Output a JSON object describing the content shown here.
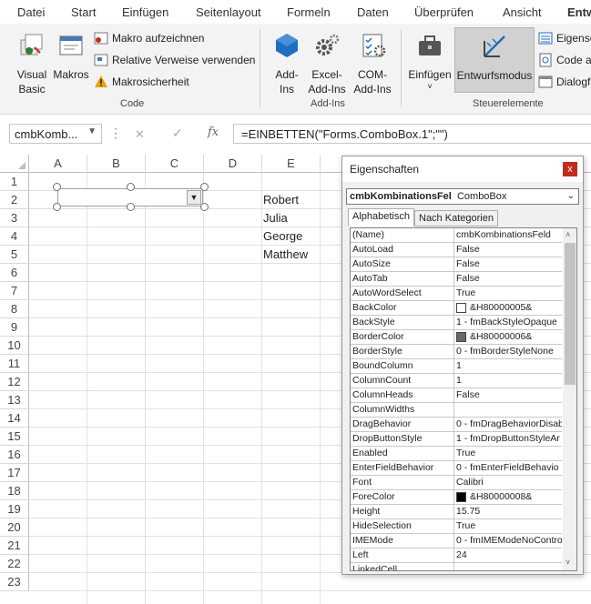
{
  "tabs": [
    "Datei",
    "Start",
    "Einfügen",
    "Seitenlayout",
    "Formeln",
    "Daten",
    "Überprüfen",
    "Ansicht",
    "Entw"
  ],
  "ribbon": {
    "code": {
      "visual_basic": "Visual Basic",
      "makros": "Makros",
      "makro_aufzeichnen": "Makro aufzeichnen",
      "relative_verweise": "Relative Verweise verwenden",
      "makrosicherheit": "Makrosicherheit",
      "group_label": "Code"
    },
    "addins": {
      "addins": "Add-Ins",
      "excel_addins": "Excel-Add-Ins",
      "com_addins": "COM-Add-Ins",
      "group_label": "Add-Ins"
    },
    "controls": {
      "einfuegen": "Einfügen",
      "entwurfsmodus": "Entwurfsmodus",
      "eigenschaften": "Eigensc",
      "code_anzeigen": "Code ar",
      "dialog": "Dialogfe",
      "group_label": "Steuerelemente"
    }
  },
  "formula_bar": {
    "name_box": "cmbKomb...",
    "fx": "fx",
    "formula": "=EINBETTEN(\"Forms.ComboBox.1\";\"\")"
  },
  "sheet": {
    "columns": [
      "A",
      "B",
      "C",
      "D",
      "E"
    ],
    "rows": [
      "1",
      "2",
      "3",
      "4",
      "5",
      "6",
      "7",
      "8",
      "9",
      "10",
      "11",
      "12",
      "13",
      "14",
      "15",
      "16",
      "17",
      "18",
      "19",
      "20",
      "21",
      "22",
      "23"
    ],
    "names": [
      "Robert",
      "Julia",
      "George",
      "Matthew"
    ]
  },
  "properties": {
    "title": "Eigenschaften",
    "close": "x",
    "object_name": "cmbKombinationsFel",
    "object_type": "ComboBox",
    "tab_alpha": "Alphabetisch",
    "tab_cat": "Nach Kategorien",
    "rows": [
      {
        "name": "(Name)",
        "value": "cmbKombinationsFeld"
      },
      {
        "name": "AutoLoad",
        "value": "False"
      },
      {
        "name": "AutoSize",
        "value": "False"
      },
      {
        "name": "AutoTab",
        "value": "False"
      },
      {
        "name": "AutoWordSelect",
        "value": "True"
      },
      {
        "name": "BackColor",
        "value": "&H80000005&",
        "swatch": "#ffffff"
      },
      {
        "name": "BackStyle",
        "value": "1 - fmBackStyleOpaque"
      },
      {
        "name": "BorderColor",
        "value": "&H80000006&",
        "swatch": "#696969"
      },
      {
        "name": "BorderStyle",
        "value": "0 - fmBorderStyleNone"
      },
      {
        "name": "BoundColumn",
        "value": "1"
      },
      {
        "name": "ColumnCount",
        "value": "1"
      },
      {
        "name": "ColumnHeads",
        "value": "False"
      },
      {
        "name": "ColumnWidths",
        "value": ""
      },
      {
        "name": "DragBehavior",
        "value": "0 - fmDragBehaviorDisab"
      },
      {
        "name": "DropButtonStyle",
        "value": "1 - fmDropButtonStyleAr"
      },
      {
        "name": "Enabled",
        "value": "True"
      },
      {
        "name": "EnterFieldBehavior",
        "value": "0 - fmEnterFieldBehavio"
      },
      {
        "name": "Font",
        "value": "Calibri"
      },
      {
        "name": "ForeColor",
        "value": "&H80000008&",
        "swatch": "#000000"
      },
      {
        "name": "Height",
        "value": "15.75"
      },
      {
        "name": "HideSelection",
        "value": "True"
      },
      {
        "name": "IMEMode",
        "value": "0 - fmIMEModeNoContro"
      },
      {
        "name": "Left",
        "value": "24"
      },
      {
        "name": "LinkedCell",
        "value": ""
      }
    ]
  },
  "colors": {
    "accent": "#1e6ebf",
    "close": "#c42b1c",
    "selected_btn": "#d1d1d1"
  }
}
